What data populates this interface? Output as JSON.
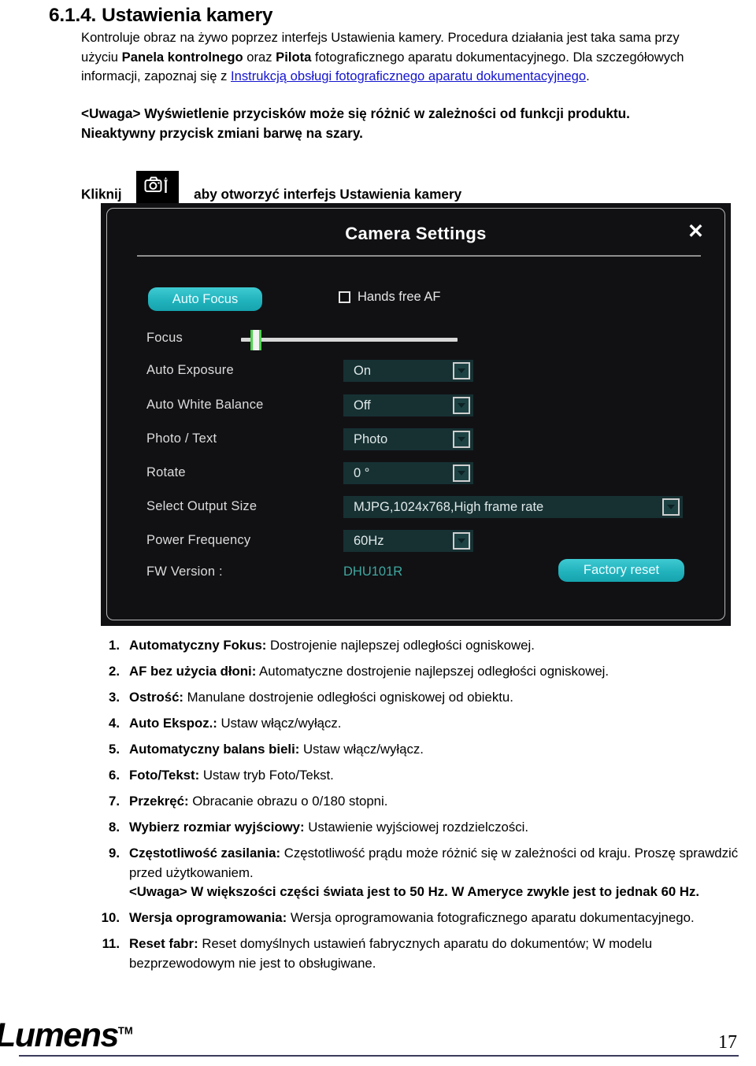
{
  "heading": {
    "number": "6.1.4.",
    "title": "Ustawienia kamery"
  },
  "intro": {
    "part1": "Kontroluje obraz na żywo poprzez interfejs Ustawienia kamery. Procedura działania jest taka sama przy użyciu ",
    "bold1": "Panela kontrolnego",
    "part2": " oraz ",
    "bold2": "Pilota",
    "part3": " fotograficznego aparatu dokumentacyjnego. Dla szczegółowych informacji, zapoznaj się z ",
    "link": "Instrukcją obsługi fotograficznego aparatu dokumentacyjnego",
    "part4": "."
  },
  "note": "<Uwaga> Wyświetlenie przycisków może się różnić w zależności od funkcji produktu. Nieaktywny przycisk zmiani barwę na szary.",
  "click_line": {
    "before": "Kliknij",
    "icon": "camera-settings-icon",
    "after": "aby otworzyć interfejs Ustawienia kamery"
  },
  "dialog": {
    "title": "Camera Settings",
    "close_label": "✕",
    "auto_focus_button": "Auto Focus",
    "hands_free_af_label": "Hands free AF",
    "hands_free_af_checked": false,
    "focus_label": "Focus",
    "focus_value_percent": 4,
    "rows": [
      {
        "label": "Auto Exposure",
        "value": "On"
      },
      {
        "label": "Auto White Balance",
        "value": "Off"
      },
      {
        "label": "Photo / Text",
        "value": "Photo"
      },
      {
        "label": "Rotate",
        "value": "0 °"
      },
      {
        "label": "Select Output Size",
        "value": "MJPG,1024x768,High frame rate"
      },
      {
        "label": "Power Frequency",
        "value": "60Hz"
      }
    ],
    "fw_version_label": "FW Version :",
    "fw_version_value": "DHU101R",
    "factory_reset_button": "Factory reset",
    "colors": {
      "background": "#111114",
      "accent_teal": "#21b3bd",
      "dropdown_bg": "#173133",
      "fw_value": "#3fa8a0",
      "slider_thumb_accent": "#4cd34c"
    }
  },
  "list": [
    {
      "num": "1.",
      "term": "Automatyczny Fokus:",
      "desc": " Dostrojenie najlepszej odległości ogniskowej."
    },
    {
      "num": "2.",
      "term": "AF bez użycia dłoni:",
      "desc": " Automatyczne dostrojenie najlepszej odległości ogniskowej."
    },
    {
      "num": "3.",
      "term": "Ostrość:",
      "desc": " Manulane dostrojenie odległości ogniskowej od obiektu."
    },
    {
      "num": "4.",
      "term": "Auto Ekspoz.:",
      "desc": " Ustaw włącz/wyłącz."
    },
    {
      "num": "5.",
      "term": "Automatyczny balans bieli:",
      "desc": " Ustaw włącz/wyłącz."
    },
    {
      "num": "6.",
      "term": "Foto/Tekst:",
      "desc": " Ustaw tryb Foto/Tekst."
    },
    {
      "num": "7.",
      "term": "Przekręć:",
      "desc": " Obracanie obrazu o 0/180 stopni."
    },
    {
      "num": "8.",
      "term": "Wybierz rozmiar wyjściowy:",
      "desc": " Ustawienie wyjściowej rozdzielczości."
    },
    {
      "num": "9.",
      "term": "Częstotliwość zasilania:",
      "desc": " Częstotliwość prądu może różnić się w zależności od kraju. Proszę sprawdzić przed użytkowaniem.",
      "note": "<Uwaga> W większości części świata jest to 50 Hz. W Ameryce zwykle jest to jednak 60 Hz."
    },
    {
      "num": "10.",
      "term": "Wersja oprogramowania:",
      "desc": " Wersja oprogramowania fotograficznego aparatu dokumentacyjnego."
    },
    {
      "num": "11.",
      "term": "Reset fabr:",
      "desc": " Reset domyślnych ustawień fabrycznych aparatu do dokumentów; W modelu bezprzewodowym nie jest to obsługiwane."
    }
  ],
  "footer": {
    "logo_text": "Lumens",
    "logo_tm": "TM",
    "page_number": "17"
  }
}
